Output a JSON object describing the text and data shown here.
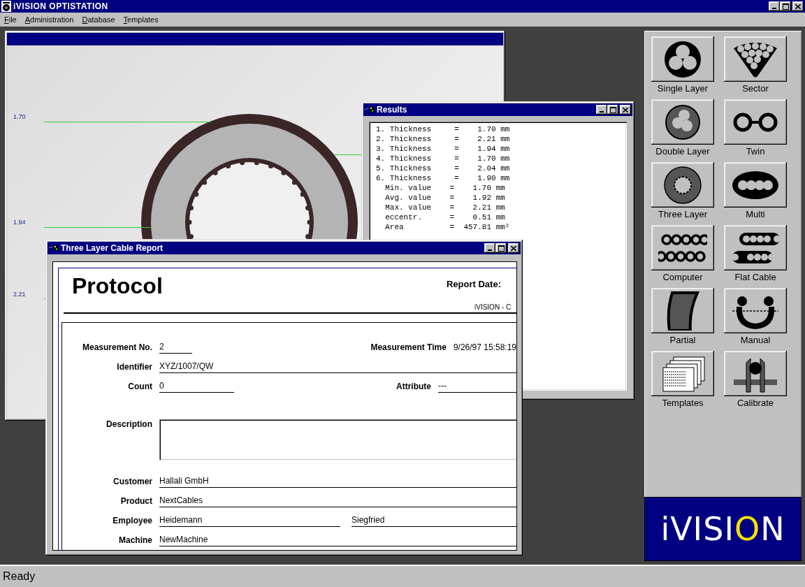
{
  "app": {
    "title": "iVISION OPTISTATION"
  },
  "menu": [
    {
      "label": "File"
    },
    {
      "label": "Administration"
    },
    {
      "label": "Database"
    },
    {
      "label": "Templates"
    }
  ],
  "image_window": {
    "measurements": [
      {
        "label": "1.70"
      },
      {
        "label": "1.94"
      },
      {
        "label": "2.21"
      }
    ]
  },
  "results_window": {
    "title": "Results",
    "lines": [
      "1. Thickness     =    1.70 mm",
      "2. Thickness     =    2.21 mm",
      "3. Thickness     =    1.94 mm",
      "4. Thickness     =    1.70 mm",
      "5. Thickness     =    2.04 mm",
      "6. Thickness     =    1.90 mm",
      "  Min. value    =    1.70 mm",
      "  Avg. value    =    1.92 mm",
      "  Max. value    =    2.21 mm",
      "  eccentr.      =    0.51 mm",
      "  Area          =  457.81 mm²"
    ]
  },
  "report_window": {
    "title": "Three Layer Cable Report",
    "heading": "Protocol",
    "report_date_label": "Report Date:",
    "company": "iVISION - C",
    "rows": [
      {
        "label": "Measurement No.",
        "value": "2",
        "kind": "short",
        "second": {
          "label": "Measurement Time",
          "value": "9/26/97 15:58:19",
          "kind": "plain"
        }
      },
      {
        "label": "Identifier",
        "value": "XYZ/1007/QW",
        "kind": "full"
      },
      {
        "label": "Count",
        "value": "0",
        "kind": "medium",
        "second": {
          "label": "Attribute",
          "value": "---",
          "kind": "attr"
        }
      },
      {
        "label": "Description",
        "kind": "box"
      },
      {
        "label": "Customer",
        "value": "Hallali GmbH",
        "kind": "full"
      },
      {
        "label": "Product",
        "value": "NextCables",
        "kind": "full"
      },
      {
        "label": "Employee",
        "value": "Heidemann",
        "kind": "wide",
        "second": {
          "value": "Siegfried",
          "kind": "tail"
        }
      },
      {
        "label": "Machine",
        "value": "NewMachine",
        "kind": "full"
      }
    ]
  },
  "cable_types": [
    {
      "label": "Single Layer",
      "kind": "single"
    },
    {
      "label": "Sector",
      "kind": "sector"
    },
    {
      "label": "Double Layer",
      "kind": "double"
    },
    {
      "label": "Twin",
      "kind": "twin"
    },
    {
      "label": "Three Layer",
      "kind": "three"
    },
    {
      "label": "Multi",
      "kind": "multi"
    },
    {
      "label": "Computer",
      "kind": "computer"
    },
    {
      "label": "Flat Cable",
      "kind": "flat"
    },
    {
      "label": "Partial",
      "kind": "partial"
    },
    {
      "label": "Manual",
      "kind": "manual"
    },
    {
      "label": "Templates",
      "kind": "templates"
    },
    {
      "label": "Calibrate",
      "kind": "calibrate"
    }
  ],
  "logo": {
    "text": "iVISION"
  },
  "status_bar": {
    "text": "Ready"
  }
}
